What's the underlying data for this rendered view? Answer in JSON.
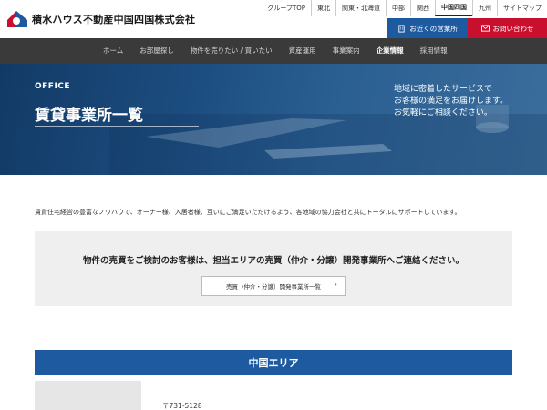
{
  "header": {
    "logo_text": "積水ハウス不動産中国四国株式会社",
    "util_nav": [
      {
        "label": "グループTOP",
        "active": false
      },
      {
        "label": "東北",
        "active": false
      },
      {
        "label": "関東・北海道",
        "active": false
      },
      {
        "label": "中部",
        "active": false
      },
      {
        "label": "関西",
        "active": false
      },
      {
        "label": "中国四国",
        "active": true
      },
      {
        "label": "九州",
        "active": false
      },
      {
        "label": "サイトマップ",
        "active": false
      }
    ],
    "office_button": "お近くの営業所",
    "contact_button": "お問い合わせ"
  },
  "mainnav": [
    {
      "label": "ホーム",
      "active": false
    },
    {
      "label": "お部屋探し",
      "active": false
    },
    {
      "label": "物件を売りたい / 買いたい",
      "active": false
    },
    {
      "label": "資産運用",
      "active": false
    },
    {
      "label": "事業案内",
      "active": false
    },
    {
      "label": "企業情報",
      "active": true
    },
    {
      "label": "採用情報",
      "active": false
    }
  ],
  "hero": {
    "label": "OFFICE",
    "title": "賃貸事業所一覧",
    "subtitle_lines": [
      "地域に密着したサービスで",
      "お客様の満足をお届けします。",
      "お気軽にご相談ください。"
    ]
  },
  "intro": "賃貸住宅経営の豊富なノウハウで、オーナー様、入居者様、互いにご満足いただけるよう、各地域の協力会社と共にトータルにサポートしています。",
  "sales_box": {
    "title": "物件の売買をご検討のお客様は、担当エリアの売買（仲介・分譲）開発事業所へご連絡ください。",
    "button": "売買（仲介・分譲）開発事業所一覧"
  },
  "area": {
    "title": "中国エリア",
    "postal": "〒731-5128"
  },
  "colors": {
    "brand_blue": "#1e5aa0",
    "brand_red": "#c8102e",
    "nav_bg": "#3a3a3a"
  }
}
